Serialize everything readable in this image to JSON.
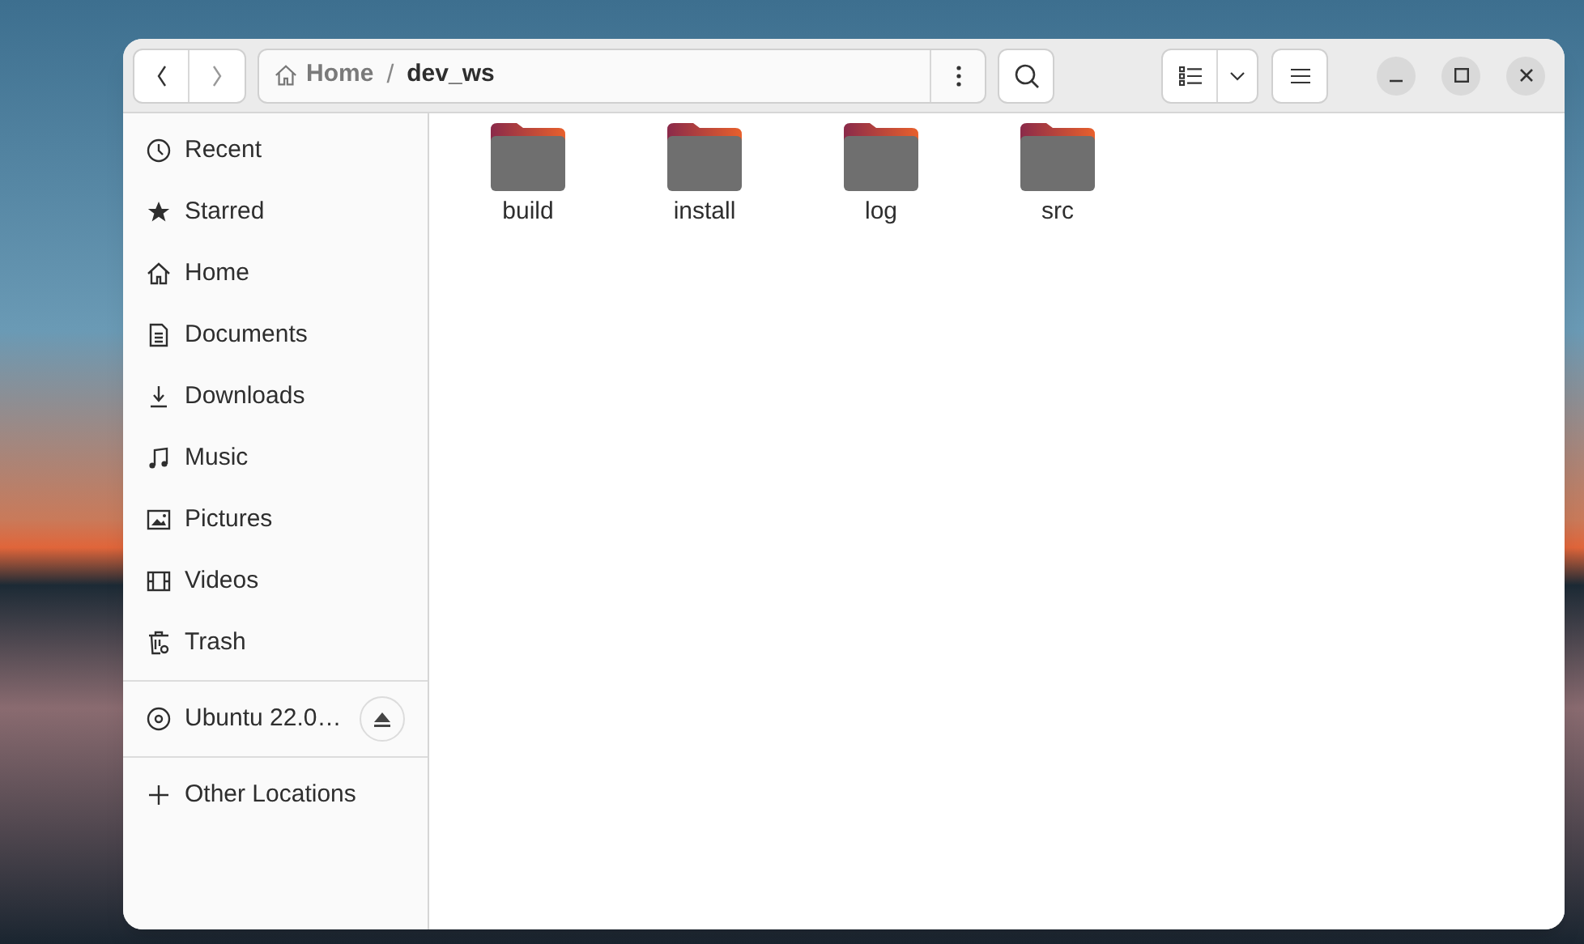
{
  "path_bar": {
    "crumbs": [
      "Home",
      "dev_ws"
    ],
    "separator": "/"
  },
  "sidebar": {
    "places": [
      "Recent",
      "Starred",
      "Home",
      "Documents",
      "Downloads",
      "Music",
      "Pictures",
      "Videos",
      "Trash"
    ],
    "devices": [
      "Ubuntu 22.0…"
    ],
    "other": [
      "Other Locations"
    ]
  },
  "folders": [
    "build",
    "install",
    "log",
    "src"
  ]
}
